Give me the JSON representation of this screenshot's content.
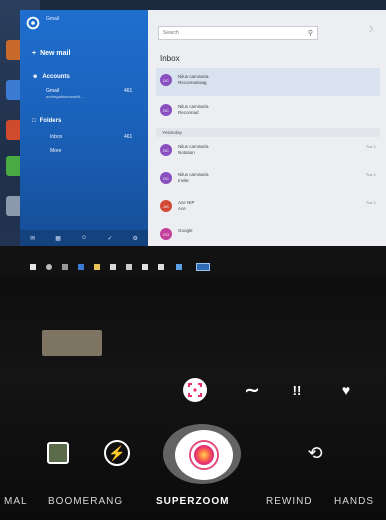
{
  "mail": {
    "account_label": "Gmail",
    "new_mail_label": "New mail",
    "accounts_label": "Accounts",
    "account": {
      "name": "Gmail",
      "email": "andregattunioamilit...",
      "count": "461"
    },
    "folders_label": "Folders",
    "folders": [
      {
        "name": "Inbox",
        "count": "461"
      },
      {
        "name": "More",
        "count": ""
      }
    ],
    "search_placeholder": "Search",
    "list_title": "Inbox",
    "date_separator": "Yesterday",
    "messages": [
      {
        "initials": "DC",
        "sender": "Nilus camisaria",
        "subject": "Reconnaissag",
        "date": "",
        "color": "#8a4fbf"
      },
      {
        "initials": "DC",
        "sender": "Nilus camisaria",
        "subject": "Reconnad",
        "date": "",
        "color": "#8a4fbf"
      },
      {
        "initials": "DC",
        "sender": "Nilus camisaria",
        "subject": "Notation",
        "date": "Tue 1",
        "color": "#8a4fbf"
      },
      {
        "initials": "DC",
        "sender": "Nilus camisaria",
        "subject": "Invite",
        "date": "Tue 1",
        "color": "#8a4fbf"
      },
      {
        "initials": "AS",
        "sender": "Ace NIP",
        "subject": "Ace",
        "date": "Tue 1",
        "color": "#d24a36"
      },
      {
        "initials": "GO",
        "sender": "Google",
        "subject": "",
        "date": "",
        "color": "#c2409b"
      }
    ]
  },
  "camera": {
    "effects": [
      {
        "icon": "superzoom-target-icon",
        "glyph": "⌖",
        "active": true
      },
      {
        "icon": "wave-icon",
        "glyph": "∼",
        "active": false
      },
      {
        "icon": "exclamation-icon",
        "glyph": "!!",
        "active": false
      },
      {
        "icon": "heart-icon",
        "glyph": "♥",
        "active": false
      }
    ],
    "flash_glyph": "⚡",
    "flip_glyph": "⟲",
    "modes": [
      "MAL",
      "BOOMERANG",
      "SUPERZOOM",
      "REWIND",
      "HANDS"
    ],
    "active_mode": "SUPERZOOM",
    "accent_color": "#e8316d"
  }
}
